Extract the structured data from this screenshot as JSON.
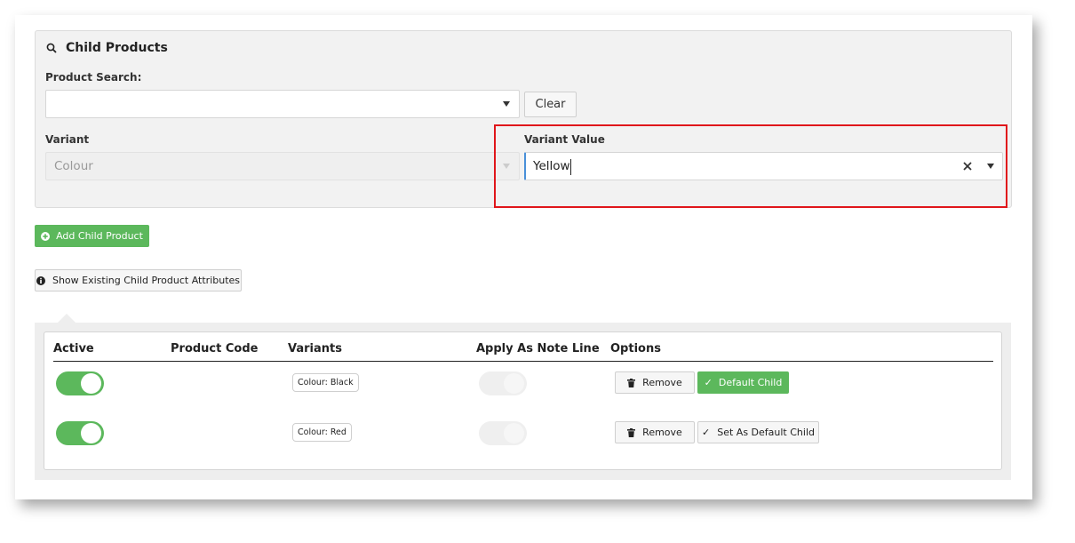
{
  "panel": {
    "title": "Child Products",
    "product_search_label": "Product Search:",
    "product_search_value": "",
    "clear_label": "Clear",
    "variant_label": "Variant",
    "variant_value": "Colour",
    "variant_value_label": "Variant Value",
    "variant_value_input": "Yellow"
  },
  "actions": {
    "add_child_label": "Add Child Product",
    "show_attributes_label": "Show Existing Child Product Attributes"
  },
  "table": {
    "headers": [
      "Active",
      "Product Code",
      "Variants",
      "Apply As Note Line",
      "Options"
    ],
    "rows": [
      {
        "active": true,
        "product_code": "",
        "variant": "Colour: Black",
        "apply_note_line": false,
        "remove_label": "Remove",
        "default_label": "Default Child"
      },
      {
        "active": true,
        "product_code": "",
        "variant": "Colour: Red",
        "apply_note_line": false,
        "remove_label": "Remove",
        "default_label": "Set As Default Child"
      }
    ]
  },
  "colors": {
    "accent_green": "#5cb85c",
    "highlight_red": "#e0161b"
  },
  "icons": [
    "search-icon",
    "plus-circle-icon",
    "info-circle-icon",
    "trash-icon",
    "check-icon",
    "clear-x-icon",
    "chevron-down-icon"
  ]
}
